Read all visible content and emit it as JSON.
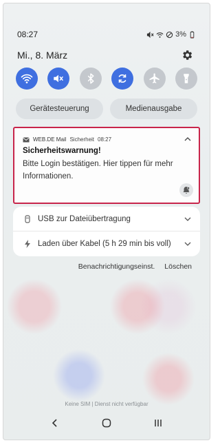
{
  "status_bar": {
    "time": "08:27",
    "battery": "3%"
  },
  "header": {
    "date": "Mi., 8. März"
  },
  "quick_toggles": [
    {
      "name": "wifi",
      "state": "on"
    },
    {
      "name": "sound-mute",
      "state": "on"
    },
    {
      "name": "bluetooth",
      "state": "off"
    },
    {
      "name": "auto-rotate",
      "state": "on"
    },
    {
      "name": "airplane-mode",
      "state": "off"
    },
    {
      "name": "flashlight",
      "state": "off"
    }
  ],
  "pills": {
    "device_control": "Gerätesteuerung",
    "media_output": "Medienausgabe"
  },
  "notification": {
    "app": "WEB.DE Mail",
    "category": "Sicherheit",
    "time": "08:27",
    "title": "Sicherheitswarnung!",
    "body": "Bitte Login bestätigen. Hier tippen für mehr Informationen."
  },
  "system_notifications": [
    {
      "label": "USB zur Dateiübertragung",
      "icon": "usb-icon"
    },
    {
      "label": "Laden über Kabel (5 h 29 min bis voll)",
      "icon": "charging-icon"
    }
  ],
  "actions": {
    "settings": "Benachrichtigungseinst.",
    "clear": "Löschen"
  },
  "footer": {
    "sim_status": "Keine SIM | Dienst nicht verfügbar"
  },
  "colors": {
    "accent": "#3f6fe0",
    "toggle_off": "#c4c8cd",
    "highlight_border": "#c8244a"
  }
}
